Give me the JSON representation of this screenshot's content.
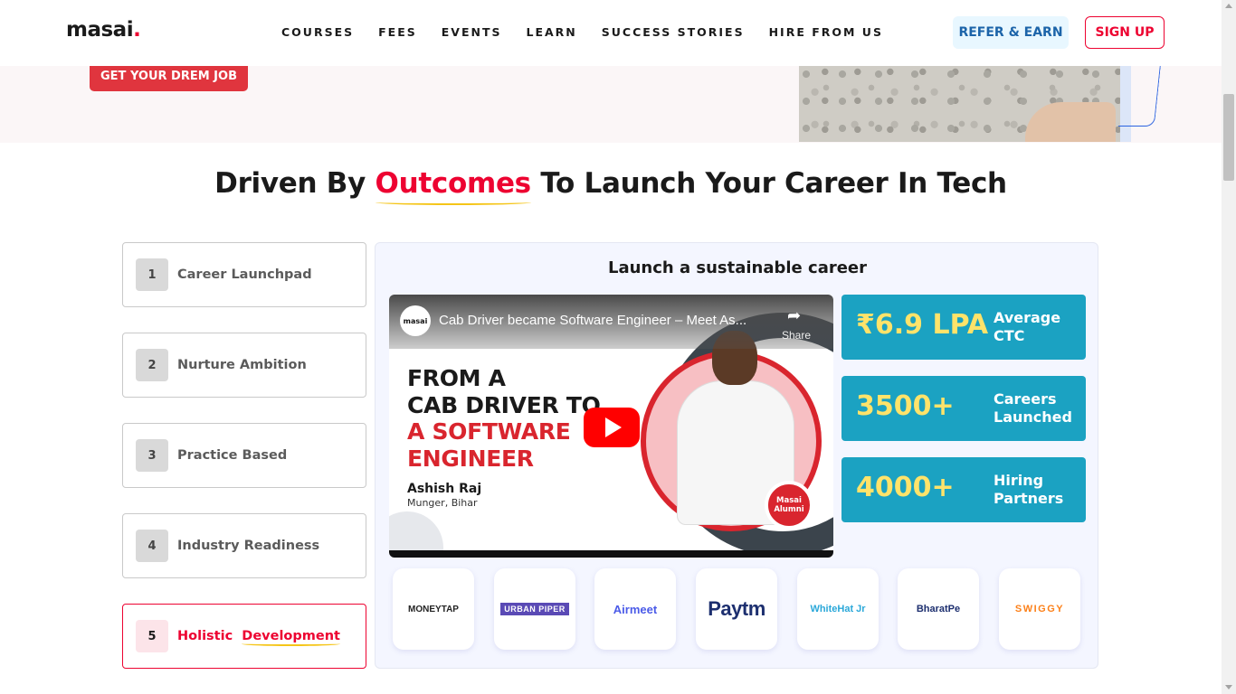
{
  "header": {
    "logo_text": "masai",
    "logo_dot": ".",
    "nav": [
      "COURSES",
      "FEES",
      "EVENTS",
      "LEARN",
      "SUCCESS STORIES",
      "HIRE FROM US"
    ],
    "refer_label": "REFER & EARN",
    "signup_label": "SIGN UP"
  },
  "hero": {
    "cta_label": "GET YOUR DREM JOB"
  },
  "section": {
    "title_pre": "Driven By",
    "title_accent": "Outcomes",
    "title_post": "To Launch Your Career In Tech"
  },
  "steps": [
    {
      "num": "1",
      "label": "Career Launchpad"
    },
    {
      "num": "2",
      "label": "Nurture Ambition"
    },
    {
      "num": "3",
      "label": "Practice Based"
    },
    {
      "num": "4",
      "label": "Industry Readiness"
    },
    {
      "num": "5",
      "label_a": "Holistic",
      "label_b": "Development"
    }
  ],
  "panel": {
    "title": "Launch a sustainable career",
    "video": {
      "channel": "masai",
      "title": "Cab Driver became Software Engineer – Meet As...",
      "share": "Share",
      "headline_1": "FROM A",
      "headline_2": "CAB DRIVER TO",
      "headline_3": "A SOFTWARE",
      "headline_4": "ENGINEER",
      "name": "Ashish Raj",
      "place": "Munger, Bihar",
      "badge": "Masai Alumni"
    },
    "stats": [
      {
        "value": "₹6.9 LPA",
        "label": "Average CTC"
      },
      {
        "value": "3500+",
        "label": "Careers Launched"
      },
      {
        "value": "4000+",
        "label": "Hiring Partners"
      }
    ],
    "partners": [
      "MONEYTAP",
      "URBAN PIPER",
      "Airmeet",
      "Paytm",
      "WhiteHat Jr",
      "BharatPe",
      "SWIGGY"
    ]
  },
  "colors": {
    "accent": "#ED0331",
    "stat_bg": "#1BA2C2",
    "stat_value": "#FFE36A",
    "panel_bg": "#F4F6FF"
  }
}
